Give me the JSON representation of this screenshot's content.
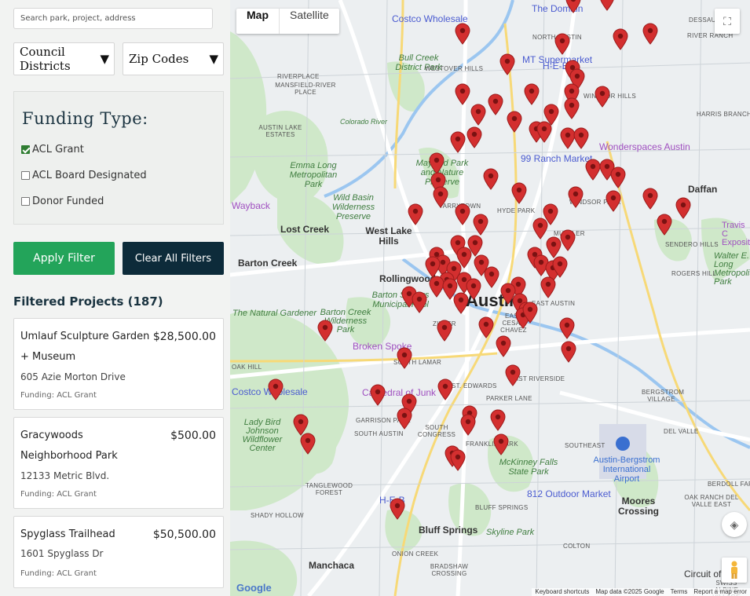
{
  "sidebar": {
    "search_placeholder": "Search park, project, address",
    "council_districts": "Council Districts",
    "zip_codes": "Zip Codes",
    "funding_title": "Funding Type:",
    "funding_options": [
      {
        "label": "ACL Grant",
        "checked": true
      },
      {
        "label": "ACL Board Designated",
        "checked": false
      },
      {
        "label": "Donor Funded",
        "checked": false
      }
    ],
    "apply_label": "Apply Filter",
    "clear_label": "Clear All Filters",
    "projects_title": "Filtered Projects (187)",
    "projects": [
      {
        "name": "Umlauf Sculpture Garden + Museum",
        "amount": "$28,500.00",
        "address": "605 Azie Morton Drive",
        "funding": "Funding: ACL Grant"
      },
      {
        "name": "Gracywoods Neighborhood Park",
        "amount": "$500.00",
        "address": "12133 Metric Blvd.",
        "funding": "Funding: ACL Grant"
      },
      {
        "name": "Spyglass Trailhead",
        "amount": "$50,500.00",
        "address": "1601 Spyglass Dr",
        "funding": "Funding: ACL Grant"
      }
    ]
  },
  "map": {
    "type_map": "Map",
    "type_satellite": "Satellite",
    "logo": "Google",
    "footer": [
      "Keyboard shortcuts",
      "Map data ©2025 Google",
      "Terms",
      "Report a map error"
    ],
    "labels": {
      "austin": "Austin",
      "lost_creek": "Lost Creek",
      "west_lake_hills": "West Lake Hills",
      "barton_creek": "Barton Creek",
      "rollingwood": "Rollingwood",
      "bluff_springs": "Bluff Springs",
      "manchaca": "Manchaca",
      "moores_crossing": "Moores Crossing",
      "daffan": "Daffan",
      "bull_creek": "Bull Creek District Park",
      "emma_long": "Emma Long Metropolitan Park",
      "wild_basin": "Wild Basin Wilderness Preserve",
      "mayfield": "Mayfield Park and Nature Preserve",
      "barton_springs": "Barton Springs Municipal Pool",
      "natural_gardener": "The Natural Gardener",
      "barton_creek_wild": "Barton Creek Wilderness Park",
      "lady_bird": "Lady Bird Johnson Wildflower Center",
      "mckinney": "McKinney Falls State Park",
      "airport": "Austin-Bergstrom International Airport",
      "costco_north": "Costco Wholesale",
      "costco_south": "Costco Wholesale",
      "mt_supermarket": "MT Supermarket",
      "heb_north": "H-E-B",
      "heb_south": "H-E-B",
      "the_domain": "The Domain",
      "ranch_market": "99 Ranch Market",
      "wonderspaces": "Wonderspaces Austin",
      "broken_spoke": "Broken Spoke",
      "cathedral_junk": "Cathedral of Junk",
      "outdoor_market": "812 Outdoor Market",
      "skyline_park": "Skyline Park",
      "circuit": "Circuit of",
      "wayback": "Wayback",
      "travis": "Travis C Exposit",
      "walter": "Walter E. Long Metropolit Park",
      "north_austin": "NORTH AUSTIN",
      "westover_hills": "WESTOVER HILLS",
      "riverplace": "RIVERPLACE",
      "mansfield": "MANSFIELD-RIVER PLACE",
      "austin_lake": "AUSTIN LAKE ESTATES",
      "windsor_hills": "WINDSOR HILLS",
      "harris_branch": "HARRIS BRANCH",
      "dessau": "DESSAU",
      "river_ranch": "RIVER RANCH",
      "hyde_park": "HYDE PARK",
      "tarrytown": "TARRYTOWN",
      "mueller": "MUELLER",
      "windsor_park": "WINDSOR PARK",
      "sendero": "SENDERO HILLS",
      "rogers_hill": "ROGERS HILL",
      "zilker": "ZILKER",
      "east_austin": "EAST AUSTIN",
      "south_lamar": "SOUTH LAMAR",
      "oak_hill": "OAK HILL",
      "st_edwards": "ST. EDWARDS",
      "parker_lane": "PARKER LANE",
      "garrison_park": "GARRISON PARK",
      "south_austin": "SOUTH AUSTIN",
      "south_congress": "SOUTH CONGRESS",
      "franklin_park": "FRANKLIN PARK",
      "southeast": "SOUTHEAST",
      "bergstrom": "BERGSTROM VILLAGE",
      "del_valle": "DEL VALLE",
      "tanglewood": "TANGLEWOOD FOREST",
      "shady_hollow": "SHADY HOLLOW",
      "bluff_springs_small": "BLUFF SPRINGS",
      "colton": "COLTON",
      "onion_creek": "ONION CREEK",
      "bradshaw": "BRADSHAW CROSSING",
      "oak_ranch": "OAK RANCH DEL VALLE EAST",
      "berdoll": "BERDOLL FARM",
      "swiss": "SWISS ALPINE VILLAGE",
      "colorado_river": "Colorado River",
      "east_riverside": "EAST RIVERSIDE",
      "easy_cha": "EAST CESAR CHAVEZ"
    }
  }
}
